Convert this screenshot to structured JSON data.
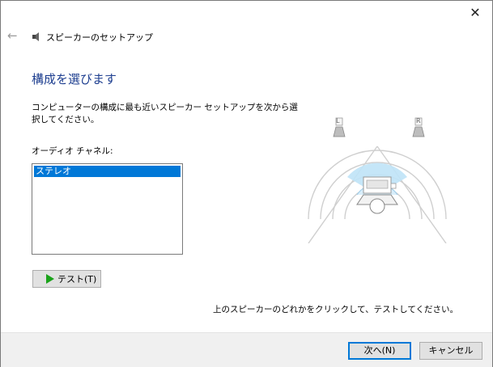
{
  "window": {
    "title": "スピーカーのセットアップ",
    "close_symbol": "✕",
    "back_symbol": "←"
  },
  "heading": "構成を選びます",
  "description": "コンピューターの構成に最も近いスピーカー セットアップを次から選択してください。",
  "channels": {
    "label": "オーディオ チャネル:",
    "items": [
      "ステレオ"
    ],
    "selected": "ステレオ"
  },
  "test_button": "テスト(T)",
  "hint": "上のスピーカーのどれかをクリックして、テストしてください。",
  "speakers": {
    "left_label": "L",
    "right_label": "R"
  },
  "footer": {
    "next_label": "次へ(N)",
    "cancel_label": "キャンセル"
  },
  "colors": {
    "accent": "#0078d7",
    "heading": "#1c3d8f",
    "play": "#1aa31a"
  }
}
